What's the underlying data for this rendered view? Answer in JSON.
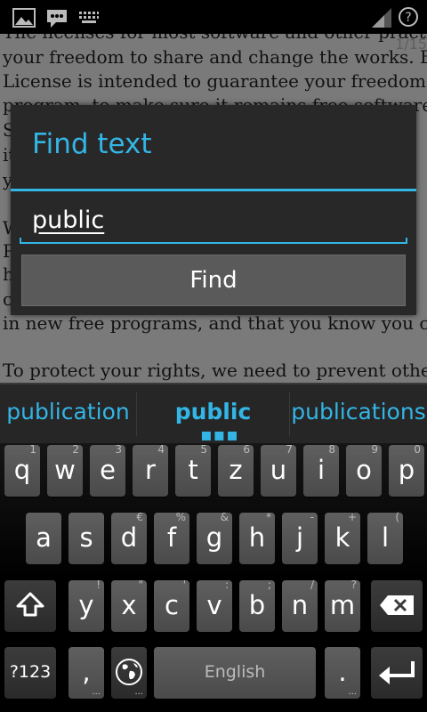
{
  "status_bar": {
    "icons": [
      "picture-icon",
      "chat-icon",
      "keyboard-icon",
      "signal-icon",
      "help-icon"
    ]
  },
  "document": {
    "page_indicator": "1/15",
    "lines": [
      "The licenses for most software and other practical",
      "your freedom to share and change the works.  By co",
      "License is intended to guarantee your freedom to sh",
      "program, to make sure it remains free software f",
      "S",
      "it",
      "y",
      "W",
      "P",
      "h",
      "c",
      "in new free programs, and that you know you can do",
      "To protect your rights, we need to prevent others f"
    ]
  },
  "dialog": {
    "title": "Find text",
    "input_value": "public",
    "find_label": "Find"
  },
  "keyboard": {
    "suggestions": [
      "publication",
      "public",
      "publications"
    ],
    "row1": [
      {
        "k": "q",
        "h": "1"
      },
      {
        "k": "w",
        "h": "2"
      },
      {
        "k": "e",
        "h": "3"
      },
      {
        "k": "r",
        "h": "4"
      },
      {
        "k": "t",
        "h": "5"
      },
      {
        "k": "z",
        "h": "6"
      },
      {
        "k": "u",
        "h": "7"
      },
      {
        "k": "i",
        "h": "8"
      },
      {
        "k": "o",
        "h": "9"
      },
      {
        "k": "p",
        "h": "0"
      }
    ],
    "row2": [
      {
        "k": "a",
        "h": ""
      },
      {
        "k": "s",
        "h": ""
      },
      {
        "k": "d",
        "h": "€"
      },
      {
        "k": "f",
        "h": "%"
      },
      {
        "k": "g",
        "h": "&"
      },
      {
        "k": "h",
        "h": "*"
      },
      {
        "k": "j",
        "h": "-"
      },
      {
        "k": "k",
        "h": "+"
      },
      {
        "k": "l",
        "h": "("
      }
    ],
    "row3": [
      {
        "k": "y",
        "h": "!"
      },
      {
        "k": "x",
        "h": "\""
      },
      {
        "k": "c",
        "h": "'"
      },
      {
        "k": "v",
        "h": ":"
      },
      {
        "k": "b",
        "h": ";"
      },
      {
        "k": "n",
        "h": "/"
      },
      {
        "k": "m",
        "h": "?"
      }
    ],
    "symbols_label": "?123",
    "comma_label": ",",
    "space_label": "English",
    "period_label": "."
  },
  "colors": {
    "accent": "#33b5e5"
  }
}
